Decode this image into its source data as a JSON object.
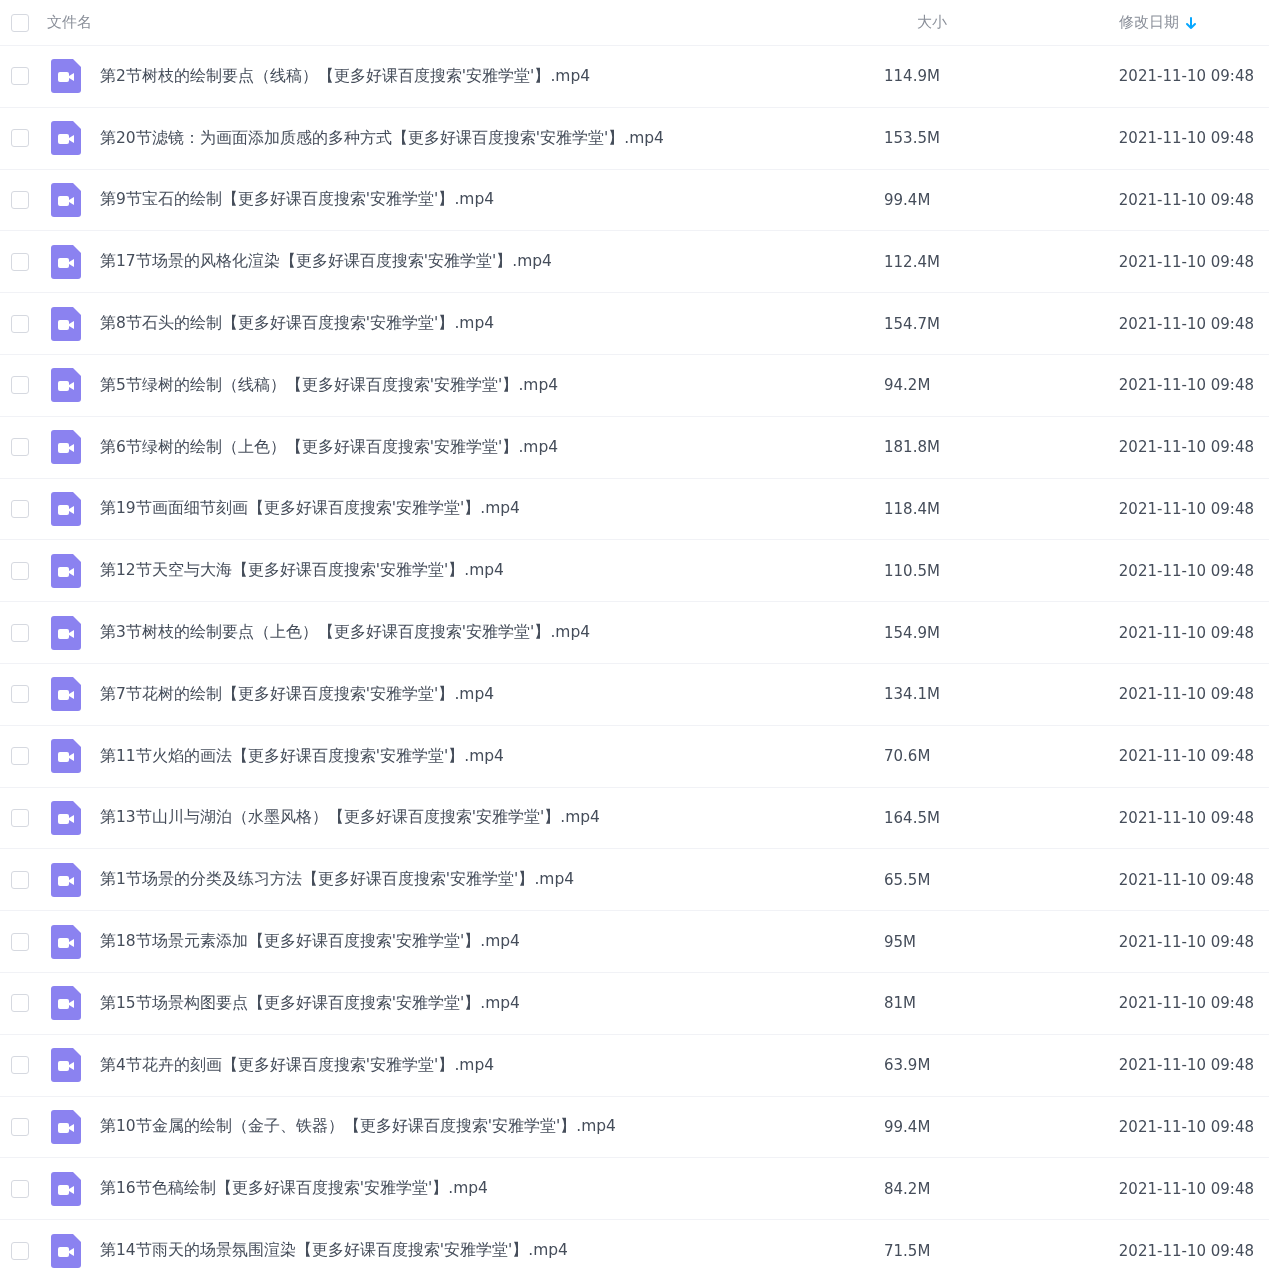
{
  "header": {
    "checked": false,
    "columns": [
      {
        "label": "文件名",
        "sorted": false
      },
      {
        "label": "大小",
        "sorted": false
      },
      {
        "label": "修改日期",
        "sorted": true
      }
    ]
  },
  "rows": [
    {
      "checked": false,
      "name": "第2节树枝的绘制要点（线稿）【更多好课百度搜索'安雅学堂'】.mp4",
      "size": "114.9M",
      "date": "2021-11-10 09:48"
    },
    {
      "checked": false,
      "name": "第20节滤镜：为画面添加质感的多种方式【更多好课百度搜索'安雅学堂'】.mp4",
      "size": "153.5M",
      "date": "2021-11-10 09:48"
    },
    {
      "checked": false,
      "name": "第9节宝石的绘制【更多好课百度搜索'安雅学堂'】.mp4",
      "size": "99.4M",
      "date": "2021-11-10 09:48"
    },
    {
      "checked": false,
      "name": "第17节场景的风格化渲染【更多好课百度搜索'安雅学堂'】.mp4",
      "size": "112.4M",
      "date": "2021-11-10 09:48"
    },
    {
      "checked": false,
      "name": "第8节石头的绘制【更多好课百度搜索'安雅学堂'】.mp4",
      "size": "154.7M",
      "date": "2021-11-10 09:48"
    },
    {
      "checked": false,
      "name": "第5节绿树的绘制（线稿）【更多好课百度搜索'安雅学堂'】.mp4",
      "size": "94.2M",
      "date": "2021-11-10 09:48"
    },
    {
      "checked": false,
      "name": "第6节绿树的绘制（上色）【更多好课百度搜索'安雅学堂'】.mp4",
      "size": "181.8M",
      "date": "2021-11-10 09:48"
    },
    {
      "checked": false,
      "name": "第19节画面细节刻画【更多好课百度搜索'安雅学堂'】.mp4",
      "size": "118.4M",
      "date": "2021-11-10 09:48"
    },
    {
      "checked": false,
      "name": "第12节天空与大海【更多好课百度搜索'安雅学堂'】.mp4",
      "size": "110.5M",
      "date": "2021-11-10 09:48"
    },
    {
      "checked": false,
      "name": "第3节树枝的绘制要点（上色）【更多好课百度搜索'安雅学堂'】.mp4",
      "size": "154.9M",
      "date": "2021-11-10 09:48"
    },
    {
      "checked": false,
      "name": "第7节花树的绘制【更多好课百度搜索'安雅学堂'】.mp4",
      "size": "134.1M",
      "date": "2021-11-10 09:48"
    },
    {
      "checked": false,
      "name": "第11节火焰的画法【更多好课百度搜索'安雅学堂'】.mp4",
      "size": "70.6M",
      "date": "2021-11-10 09:48"
    },
    {
      "checked": false,
      "name": "第13节山川与湖泊（水墨风格）【更多好课百度搜索'安雅学堂'】.mp4",
      "size": "164.5M",
      "date": "2021-11-10 09:48"
    },
    {
      "checked": false,
      "name": "第1节场景的分类及练习方法【更多好课百度搜索'安雅学堂'】.mp4",
      "size": "65.5M",
      "date": "2021-11-10 09:48"
    },
    {
      "checked": false,
      "name": "第18节场景元素添加【更多好课百度搜索'安雅学堂'】.mp4",
      "size": "95M",
      "date": "2021-11-10 09:48"
    },
    {
      "checked": false,
      "name": "第15节场景构图要点【更多好课百度搜索'安雅学堂'】.mp4",
      "size": "81M",
      "date": "2021-11-10 09:48"
    },
    {
      "checked": false,
      "name": "第4节花卉的刻画【更多好课百度搜索'安雅学堂'】.mp4",
      "size": "63.9M",
      "date": "2021-11-10 09:48"
    },
    {
      "checked": false,
      "name": "第10节金属的绘制（金子、铁器）【更多好课百度搜索'安雅学堂'】.mp4",
      "size": "99.4M",
      "date": "2021-11-10 09:48"
    },
    {
      "checked": false,
      "name": "第16节色稿绘制【更多好课百度搜索'安雅学堂'】.mp4",
      "size": "84.2M",
      "date": "2021-11-10 09:48"
    },
    {
      "checked": false,
      "name": "第14节雨天的场景氛围渲染【更多好课百度搜索'安雅学堂'】.mp4",
      "size": "71.5M",
      "date": "2021-11-10 09:48"
    }
  ]
}
